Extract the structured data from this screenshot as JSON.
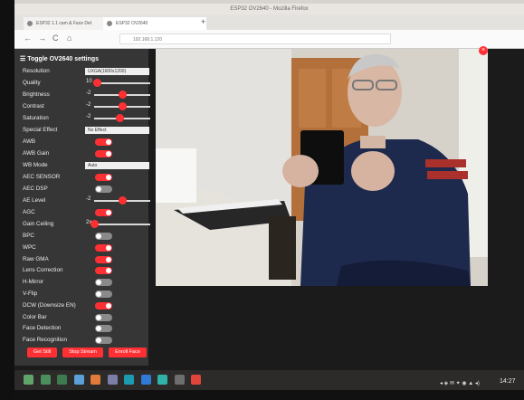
{
  "browser": {
    "window_title": "ESP32 OV2640 - Mozilla Firefox",
    "tabs": [
      {
        "label": "ESP32 1.1 cam & Face Det"
      },
      {
        "label": "ESP32 OV2640"
      }
    ],
    "new_tab": "+",
    "url": "192.168.1.120",
    "nav": {
      "back": "←",
      "forward": "→",
      "reload": "C",
      "home": "⌂"
    }
  },
  "panel": {
    "toggle_label": "Toggle OV2640 settings",
    "resolution": {
      "label": "Resolution",
      "value": "UXGA(1600x1200)"
    },
    "sliders": [
      {
        "label": "Quality",
        "min": "10",
        "value": 0.05
      },
      {
        "label": "Brightness",
        "min": "-2",
        "value": 0.5
      },
      {
        "label": "Contrast",
        "min": "-2",
        "value": 0.5
      },
      {
        "label": "Saturation",
        "min": "-2",
        "value": 0.45
      }
    ],
    "special_effect": {
      "label": "Special Effect",
      "value": "No Effect"
    },
    "toggles_a": [
      {
        "label": "AWB",
        "on": true
      },
      {
        "label": "AWB Gain",
        "on": true
      }
    ],
    "wb_mode": {
      "label": "WB Mode",
      "value": "Auto"
    },
    "toggles_b": [
      {
        "label": "AEC SENSOR",
        "on": true
      },
      {
        "label": "AEC DSP",
        "on": false
      }
    ],
    "ae_level": {
      "label": "AE Level",
      "min": "-2",
      "value": 0.5
    },
    "agc": {
      "label": "AGC",
      "on": true
    },
    "gain_ceiling": {
      "label": "Gain Ceiling",
      "min": "2x",
      "value": 0.0
    },
    "toggles_c": [
      {
        "label": "BPC",
        "on": false
      },
      {
        "label": "WPC",
        "on": true
      },
      {
        "label": "Raw GMA",
        "on": true
      },
      {
        "label": "Lens Correction",
        "on": true
      },
      {
        "label": "H-Mirror",
        "on": false
      },
      {
        "label": "V-Flip",
        "on": false
      },
      {
        "label": "DCW (Downsize EN)",
        "on": true
      },
      {
        "label": "Color Bar",
        "on": false
      },
      {
        "label": "Face Detection",
        "on": false
      },
      {
        "label": "Face Recognition",
        "on": false
      }
    ],
    "buttons": {
      "get_still": "Get Still",
      "stop_stream": "Stop Stream",
      "enroll_face": "Enroll Face"
    }
  },
  "stream": {
    "close": "×"
  },
  "taskbar": {
    "icons": [
      "files-icon",
      "folder-icon",
      "terminal-icon",
      "home-icon",
      "firefox-icon",
      "settings-icon",
      "arduino-icon",
      "vscode-icon",
      "editor-icon",
      "calculator-icon",
      "app-icon"
    ],
    "icon_colors": [
      "#5fa56a",
      "#4a8f5c",
      "#3d7a4e",
      "#5ba0d8",
      "#e07b39",
      "#7b7fa8",
      "#1c9bb0",
      "#2f7ad4",
      "#2fb3a8",
      "#6e6e6e",
      "#e0443a"
    ],
    "tray": "◂ ◈ ✉ ✦ ◉ ▲ ◂)",
    "clock": "14:27"
  },
  "colors": {
    "accent": "#ff3034",
    "panel_bg": "#363636"
  }
}
